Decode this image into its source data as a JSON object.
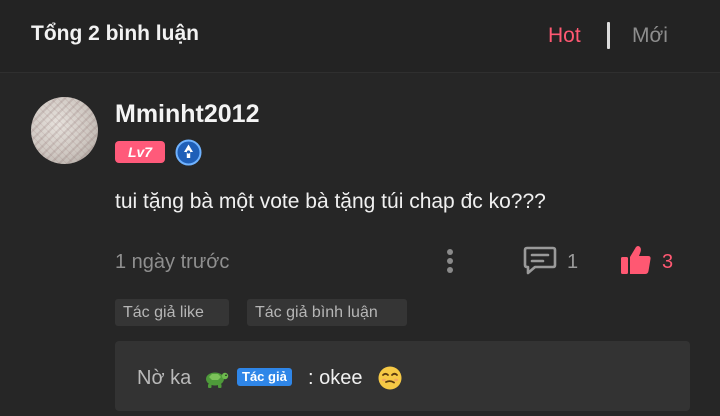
{
  "header": {
    "title": "Tổng 2 bình luận",
    "sort_options": [
      "Hot",
      "Mới"
    ],
    "active_sort": "Hot"
  },
  "comment": {
    "username": "Mminht2012",
    "level": "Lv7",
    "verified_icon": "verified-badge-icon",
    "text": "tui tặng bà một vote bà tặng túi chap đc ko???",
    "timestamp": "1 ngày trước",
    "reply_count": "1",
    "like_count": "3",
    "tags": [
      "Tác giả like",
      "Tác giả bình luận"
    ]
  },
  "reply": {
    "author": "Nờ ka",
    "author_emoji_icon": "turtle-icon",
    "author_badge": "Tác giả",
    "text": ": okee",
    "emoji_icon": "face-icon"
  },
  "colors": {
    "accent": "#ff5872",
    "background": "#262626",
    "author_badge": "#2f86e8"
  }
}
